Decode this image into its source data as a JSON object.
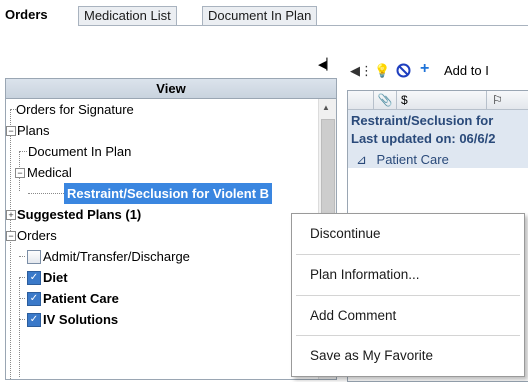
{
  "tabs": [
    {
      "label": "Orders",
      "active": true
    },
    {
      "label": "Medication List",
      "active": false
    },
    {
      "label": "Document In Plan",
      "active": false
    }
  ],
  "tree": {
    "header": "View",
    "rows": {
      "orders_for_signature": "Orders for Signature",
      "plans": "Plans",
      "document_in_plan": "Document In Plan",
      "medical": "Medical",
      "restraint": "Restraint/Seclusion for Violent B",
      "suggested_plans": "Suggested Plans (1)",
      "orders": "Orders",
      "admit": "Admit/Transfer/Discharge",
      "diet": "Diet",
      "patient_care": "Patient Care",
      "iv_solutions": "IV Solutions"
    },
    "checkboxes": {
      "admit": false,
      "diet": true,
      "patient_care": true,
      "iv_solutions": true
    }
  },
  "toolbar": {
    "add_label": "Add to I"
  },
  "grid": {
    "col_dollar": "$",
    "plan_title": "Restraint/Seclusion for",
    "plan_updated": "Last updated on: 06/6/2",
    "section": "Patient Care"
  },
  "context_menu": {
    "items": [
      "Discontinue",
      "Plan Information...",
      "Add Comment",
      "Save as My Favorite"
    ]
  },
  "colors": {
    "selection": "#3a86e0",
    "checkbox_checked": "#3a79c9",
    "add_icon": "#1e73d8",
    "prohibit_icon": "#1f3fbf"
  }
}
